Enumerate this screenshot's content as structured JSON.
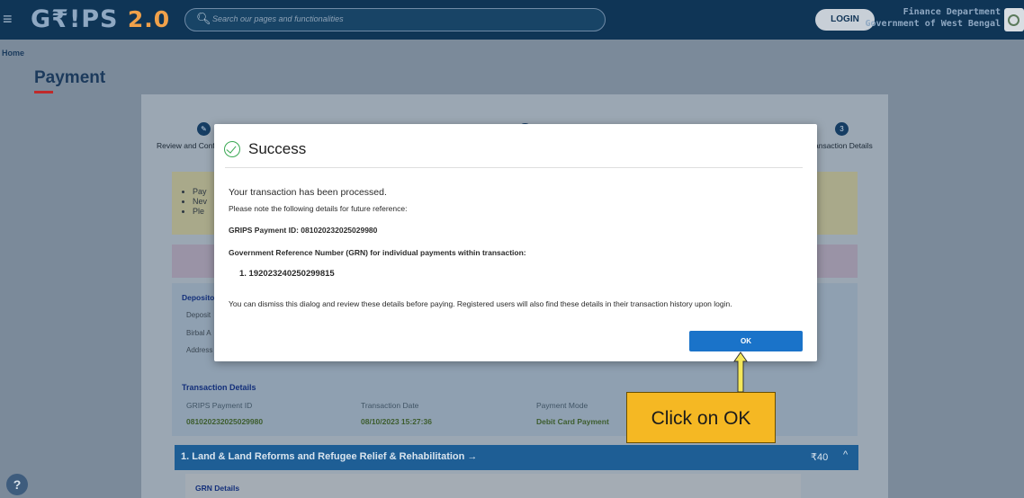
{
  "header": {
    "logo_main": "G₹!PS",
    "logo_version": "2.0",
    "search_placeholder": "Search our pages and functionalities",
    "login_label": "LOGIN",
    "dept_line1": "Finance Department",
    "dept_line2": "Government of West Bengal"
  },
  "breadcrumb": {
    "home": "Home"
  },
  "page": {
    "title": "Payment"
  },
  "stepper": {
    "step1_label": "Review and Confi",
    "step3_number": "3",
    "step3_label": "ansaction Details"
  },
  "notice_items": [
    "Pay",
    "Nev",
    "Ple"
  ],
  "depositor": {
    "title": "Deposito",
    "line1": "Deposit",
    "line2": "Birbal A",
    "line3": "Address"
  },
  "transaction_details": {
    "title": "Transaction Details",
    "labels": [
      "GRIPS Payment ID",
      "Transaction Date",
      "Payment Mode"
    ],
    "values": [
      "081020232025029980",
      "08/10/2023 15:27:36",
      "Debit Card Payment"
    ]
  },
  "department_bar": {
    "label": "1. Land & Land Reforms and Refugee Relief & Rehabilitation →",
    "amount": "₹40",
    "chevron": "^"
  },
  "grn_details": {
    "title": "GRN Details"
  },
  "modal": {
    "title": "Success",
    "processed": "Your transaction has been processed.",
    "note": "Please note the following details for future reference:",
    "payment_id_line": "GRIPS Payment ID: 081020232025029980",
    "grn_heading": "Government Reference Number (GRN) for individual payments within transaction:",
    "grn_item": "1. 192023240250299815",
    "dismiss_text": "You can dismiss this dialog and review these details before paying. Registered users will also find these details in their transaction history upon login.",
    "ok_label": "OK"
  },
  "annotation": {
    "callout_text": "Click on OK",
    "color": "#f5b823"
  },
  "colors": {
    "header_bg": "#0f3556",
    "primary_button": "#1a73c9",
    "success_green": "#39a852",
    "accent_red": "#c02a2a"
  }
}
